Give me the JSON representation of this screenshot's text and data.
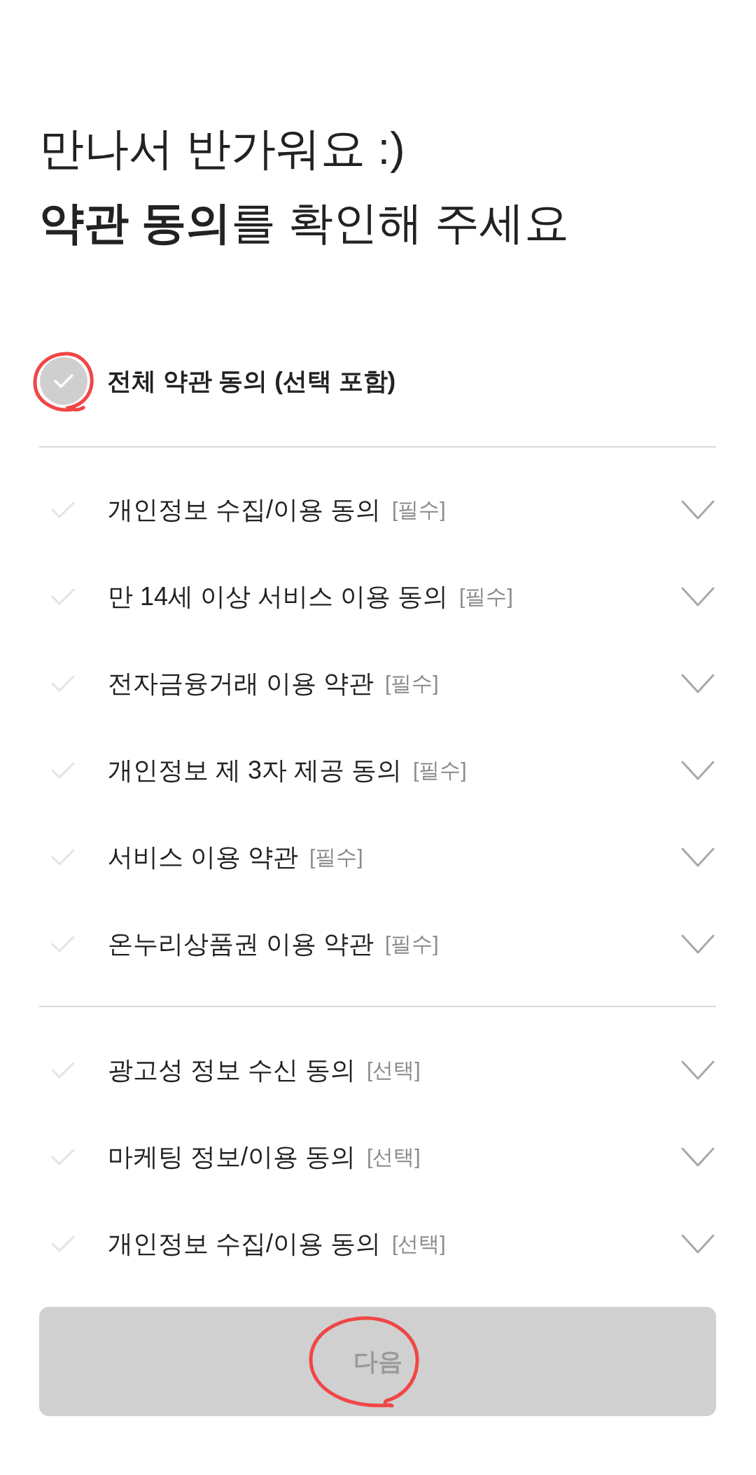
{
  "heading": {
    "line_1": "만나서 반가워요 :)",
    "line_2": "**약관 동의**를 확인해 주세요"
  },
  "agree_all": {
    "label": "전체 약관 동의 (선택 포함)",
    "checked": false,
    "circled": true
  },
  "required_terms": [
    {
      "label": "개인정보 수집/이용 동의",
      "tag": "[필수]",
      "checked": false,
      "expanded": false
    },
    {
      "label": "만 14세 이상 서비스 이용 동의",
      "tag": "[필수]",
      "checked": false,
      "expanded": false
    },
    {
      "label": "전자금융거래 이용 약관",
      "tag": "[필수]",
      "checked": false,
      "expanded": false
    },
    {
      "label": "개인정보 제 3자 제공 동의",
      "tag": "[필수]",
      "checked": false,
      "expanded": false
    },
    {
      "label": "서비스 이용 약관",
      "tag": "[필수]",
      "checked": false,
      "expanded": false
    },
    {
      "label": "온누리상품권 이용 약관",
      "tag": "[필수]",
      "checked": false,
      "expanded": false
    }
  ],
  "optional_terms": [
    {
      "label": "광고성 정보 수신 동의",
      "tag": "[선택]",
      "checked": false,
      "expanded": false
    },
    {
      "label": "마케팅 정보/이용 동의",
      "tag": "[선택]",
      "checked": false,
      "expanded": false
    },
    {
      "label": "개인정보 수집/이용 동의",
      "tag": "[선택]",
      "checked": false,
      "expanded": false
    }
  ],
  "next_button": {
    "label": "다음",
    "disabled": true,
    "circled": true
  }
}
